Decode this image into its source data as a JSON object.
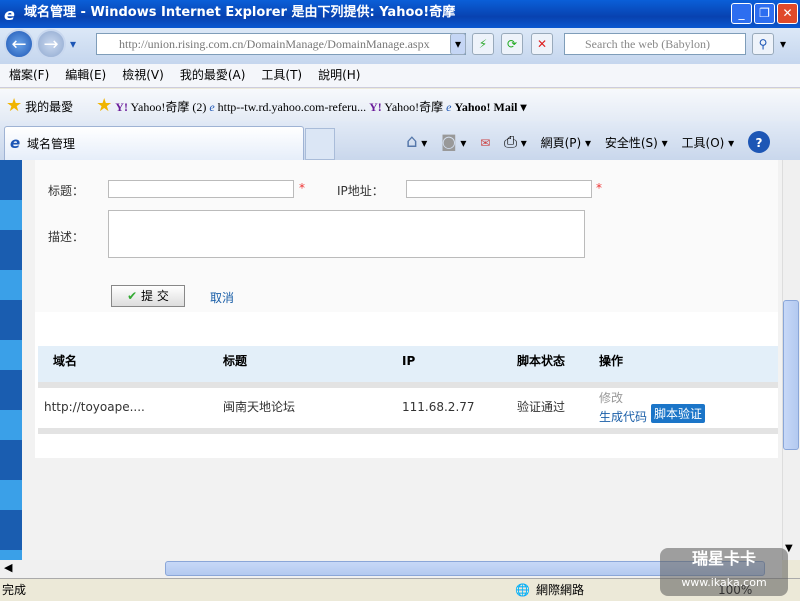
{
  "window": {
    "title": "域名管理 - Windows Internet Explorer 是由下列提供: Yahoo!奇摩"
  },
  "address": {
    "url": "http://union.rising.com.cn/DomainManage/DomainManage.aspx",
    "search_placeholder": "Search the web (Babylon)"
  },
  "menu": [
    "檔案(F)",
    "編輯(E)",
    "檢視(V)",
    "我的最愛(A)",
    "工具(T)",
    "說明(H)"
  ],
  "favorites": {
    "label": "我的最愛",
    "items": [
      "Yahoo!奇摩 (2)",
      "http--tw.rd.yahoo.com-referu...",
      "Yahoo!奇摩",
      "Yahoo! Mail ▾"
    ]
  },
  "tab": {
    "title": "域名管理"
  },
  "commands": [
    "網頁(P) ▾",
    "安全性(S) ▾",
    "工具(O) ▾"
  ],
  "form": {
    "title_label": "标题：",
    "ip_label": "IP地址：",
    "desc_label": "描述：",
    "required": "*",
    "submit": "提 交",
    "cancel": "取消"
  },
  "table": {
    "headers": [
      "域名",
      "标题",
      "IP",
      "脚本状态",
      "操作"
    ],
    "rows": [
      {
        "domain": "http://toyoape....",
        "title": "闽南天地论坛",
        "ip": "111.68.2.77",
        "status": "验证通过",
        "edit": "修改",
        "gen": "生成代码",
        "verify": "脚本验证"
      }
    ]
  },
  "status": {
    "text": "完成",
    "zone": "網際網路",
    "zoom": "100%"
  },
  "watermark": {
    "line1": "瑞星卡卡",
    "line2": "www.ikaka.com"
  }
}
